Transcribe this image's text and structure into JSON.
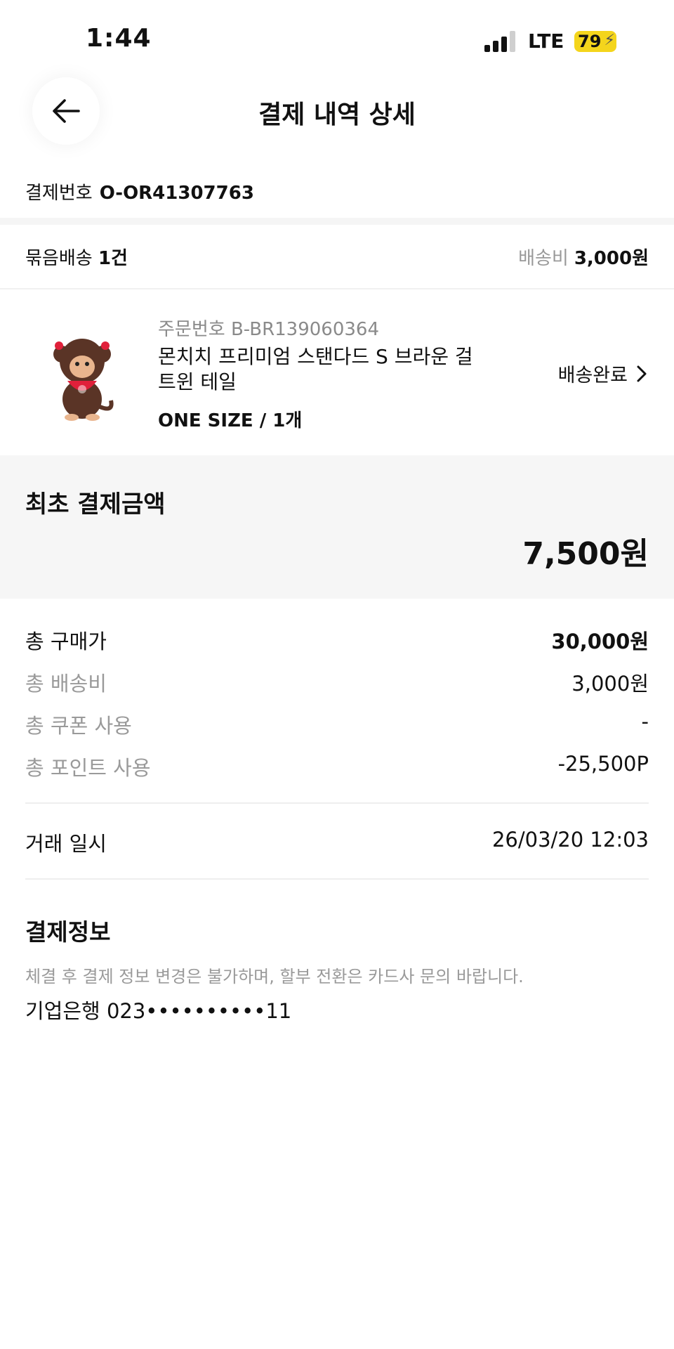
{
  "status_bar": {
    "time": "1:44",
    "network": "LTE",
    "battery": "79"
  },
  "header": {
    "title": "결제 내역 상세"
  },
  "payment": {
    "label": "결제번호",
    "number": "O-OR41307763"
  },
  "bundle": {
    "label": "묶음배송",
    "count": "1건",
    "shipping_label": "배송비",
    "shipping_value": "3,000원"
  },
  "product": {
    "order_no": "주문번호 B-BR139060364",
    "name": "몬치치 프리미엄 스탠다드 S 브라운 걸 트윈 테일",
    "option": "ONE SIZE / 1개",
    "status": "배송완료",
    "image_icon": "monchhichi-doll"
  },
  "summary": {
    "title": "최초 결제금액",
    "amount": "7,500원"
  },
  "breakdown": [
    {
      "label": "총 구매가",
      "value": "30,000원"
    },
    {
      "label": "총 배송비",
      "value": "3,000원"
    },
    {
      "label": "총 쿠폰 사용",
      "value": "-"
    },
    {
      "label": "총 포인트 사용",
      "value": "-25,500P"
    }
  ],
  "transaction": {
    "label": "거래 일시",
    "value": "26/03/20 12:03"
  },
  "payment_info": {
    "title": "결제정보",
    "note": "체결 후 결제 정보 변경은 불가하며, 할부 전환은 카드사 문의 바랍니다.",
    "account": "기업은행 023••••••••••11"
  },
  "colors": {
    "battery": "#f4d51c",
    "summary_bg": "#f6f6f6",
    "muted_text": "#9a9a9a"
  }
}
